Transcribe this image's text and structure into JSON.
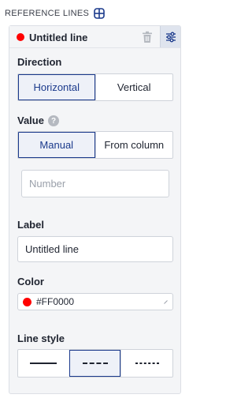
{
  "header": {
    "title": "REFERENCE LINES",
    "add_icon": "plus-square-icon"
  },
  "line": {
    "name": "Untitled line",
    "dot_color": "#FF0000",
    "delete_icon": "trash-icon",
    "settings_icon": "sliders-icon"
  },
  "direction": {
    "label": "Direction",
    "options": [
      "Horizontal",
      "Vertical"
    ],
    "selected": "Horizontal"
  },
  "value": {
    "label": "Value",
    "help_icon": "?",
    "options": [
      "Manual",
      "From column"
    ],
    "selected": "Manual",
    "number_placeholder": "Number"
  },
  "label_field": {
    "label": "Label",
    "value": "Untitled line"
  },
  "color": {
    "label": "Color",
    "value": "#FF0000"
  },
  "line_style": {
    "label": "Line style",
    "options": [
      "solid",
      "dashed",
      "dotted"
    ],
    "selected": "dashed"
  },
  "colors": {
    "accent": "#1B3A8C",
    "panel_bg": "#F4F5F7",
    "red": "#FF0000"
  }
}
